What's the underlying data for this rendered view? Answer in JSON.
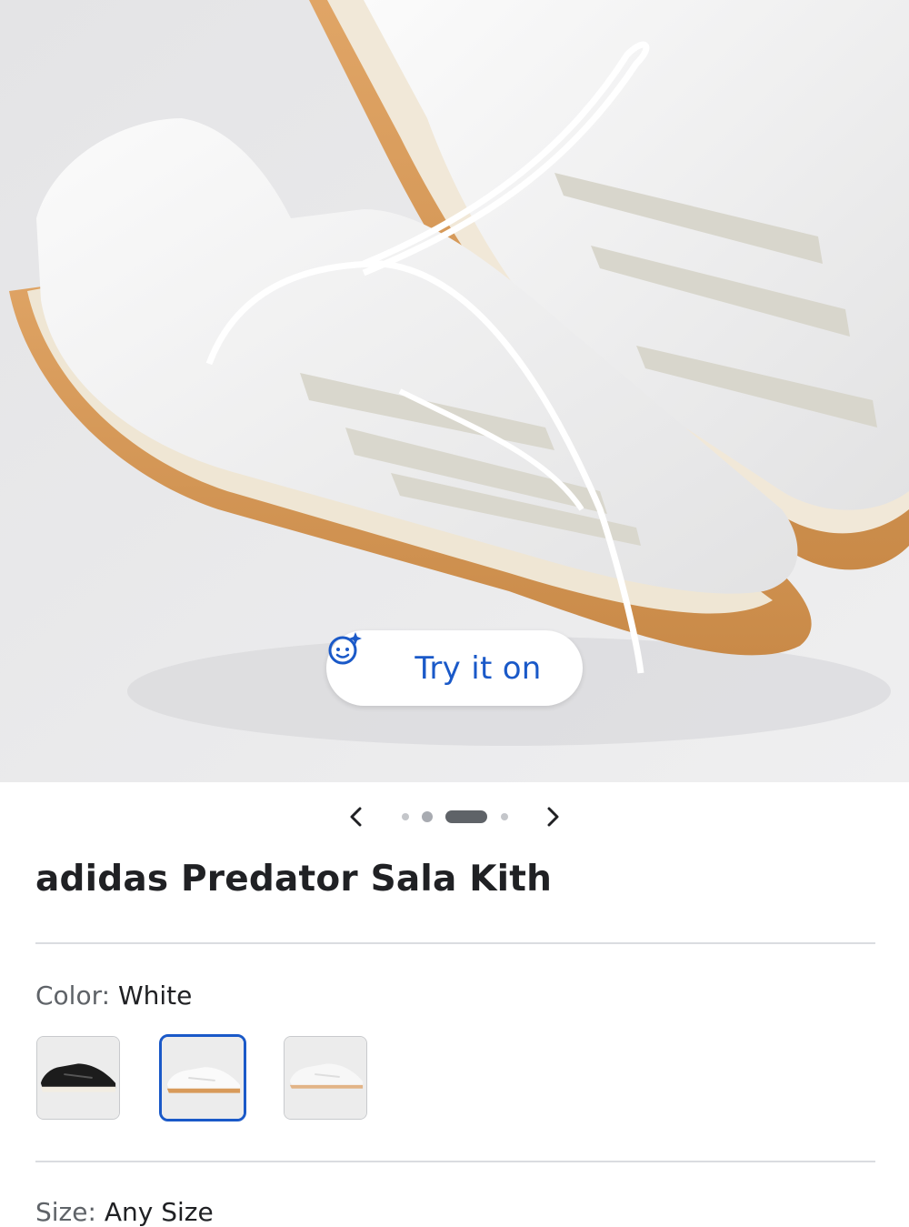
{
  "hero": {
    "image": "white-leather-indoor-soccer-shoes-gum-sole",
    "try_on": {
      "label": "Try it on",
      "icon": "face-sparkle-icon",
      "color": "#1a59c8"
    }
  },
  "carousel": {
    "prev_icon": "chevron-left-icon",
    "next_icon": "chevron-right-icon",
    "total_images": 4,
    "active_index": 2
  },
  "product": {
    "title": "adidas Predator Sala Kith"
  },
  "color": {
    "label": "Color:",
    "value": "White",
    "swatches": [
      {
        "name": "Black",
        "selected": false
      },
      {
        "name": "White",
        "selected": true
      },
      {
        "name": "White",
        "selected": false
      }
    ],
    "selected_border": "#1a59c8"
  },
  "size": {
    "label": "Size:",
    "value": "Any Size"
  }
}
